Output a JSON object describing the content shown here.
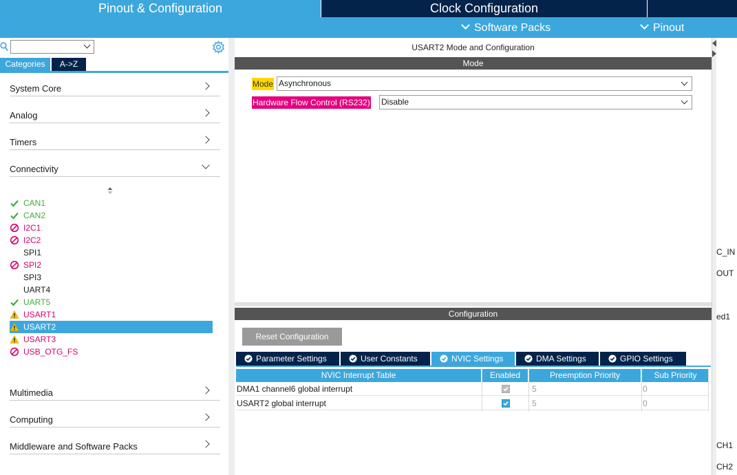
{
  "top_tabs": {
    "pinout": "Pinout & Configuration",
    "clock": "Clock Configuration"
  },
  "sub_menu": {
    "software_packs": "Software Packs",
    "pinout": "Pinout"
  },
  "left": {
    "search_value": "",
    "tab_categories": "Categories",
    "tab_az": "A->Z",
    "categories_top": [
      "System Core",
      "Analog",
      "Timers",
      "Connectivity"
    ],
    "peripherals": [
      {
        "name": "CAN1",
        "status": "check"
      },
      {
        "name": "CAN2",
        "status": "check"
      },
      {
        "name": "I2C1",
        "status": "blocked"
      },
      {
        "name": "I2C2",
        "status": "blocked"
      },
      {
        "name": "SPI1",
        "status": "none"
      },
      {
        "name": "SPI2",
        "status": "blocked"
      },
      {
        "name": "SPI3",
        "status": "none"
      },
      {
        "name": "UART4",
        "status": "none"
      },
      {
        "name": "UART5",
        "status": "check"
      },
      {
        "name": "USART1",
        "status": "warning"
      },
      {
        "name": "USART2",
        "status": "warning",
        "selected": true
      },
      {
        "name": "USART3",
        "status": "warning"
      },
      {
        "name": "USB_OTG_FS",
        "status": "blocked"
      }
    ],
    "categories_bottom": [
      "Multimedia",
      "Computing",
      "Middleware and Software Packs"
    ]
  },
  "mode_panel": {
    "title": "USART2 Mode and Configuration",
    "header": "Mode",
    "mode_label": "Mode",
    "mode_value": "Asynchronous",
    "hfc_label": "Hardware Flow Control (RS232)",
    "hfc_value": "Disable"
  },
  "config_panel": {
    "header": "Configuration",
    "reset_button": "Reset Configuration",
    "tabs": [
      "Parameter Settings",
      "User Constants",
      "NVIC Settings",
      "DMA Settings",
      "GPIO Settings"
    ],
    "active_tab": "NVIC Settings",
    "table": {
      "headers": [
        "NVIC Interrupt Table",
        "Enabled",
        "Preemption Priority",
        "Sub Priority"
      ],
      "rows": [
        {
          "name": "DMA1 channel6 global interrupt",
          "enabled": true,
          "enabled_locked": true,
          "preemption": "5",
          "sub": "0"
        },
        {
          "name": "USART2 global interrupt",
          "enabled": true,
          "enabled_locked": false,
          "preemption": "5",
          "sub": "0"
        }
      ]
    }
  },
  "right_strip": {
    "labels": [
      "C_IN",
      "OUT",
      "ed1",
      "CH1",
      "CH2"
    ]
  },
  "colors": {
    "accent_blue": "#3ca7dc",
    "navy": "#03234b",
    "header_gray": "#545454",
    "ok_green": "#3fae3f",
    "error_pink": "#d9006c",
    "mode_yellow": "#ffd700",
    "hfc_magenta": "#e6007e"
  }
}
